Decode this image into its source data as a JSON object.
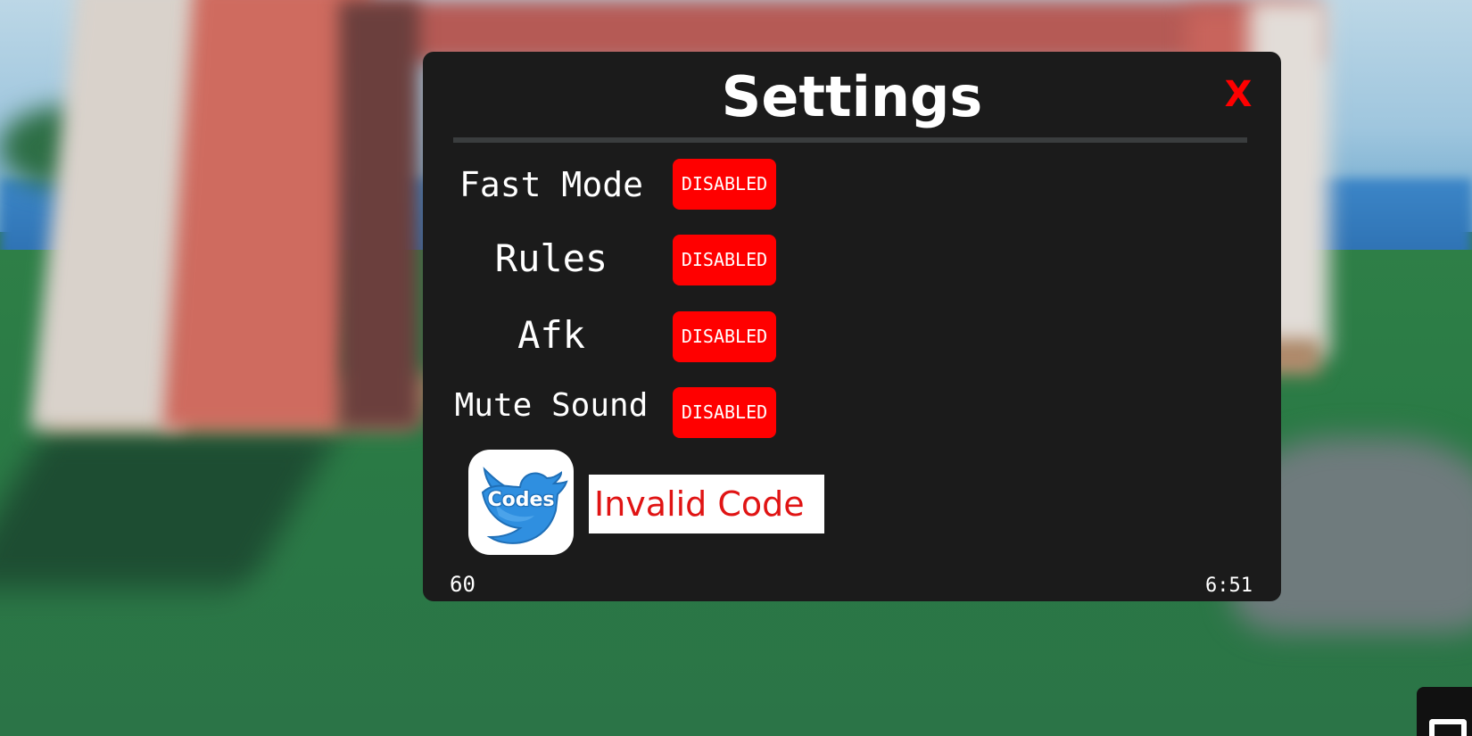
{
  "settings": {
    "title": "Settings",
    "close_label": "X",
    "rows": [
      {
        "label": "Fast Mode",
        "state": "DISABLED"
      },
      {
        "label": "Rules",
        "state": "DISABLED"
      },
      {
        "label": "Afk",
        "state": "DISABLED"
      },
      {
        "label": "Mute Sound",
        "state": "DISABLED"
      }
    ],
    "codes": {
      "button_label": "Codes",
      "input_value": "Invalid Code"
    },
    "footer": {
      "fps": "60",
      "time": "6:51"
    }
  },
  "colors": {
    "panel_bg": "#1b1b1b",
    "toggle_disabled": "#ff0000",
    "close": "#ff0000",
    "error_text": "#e01414",
    "twitter_blue": "#2f8fe0"
  },
  "icons": {
    "codes_button": "twitter-bird-icon",
    "corner_widget": "chat-icon"
  }
}
